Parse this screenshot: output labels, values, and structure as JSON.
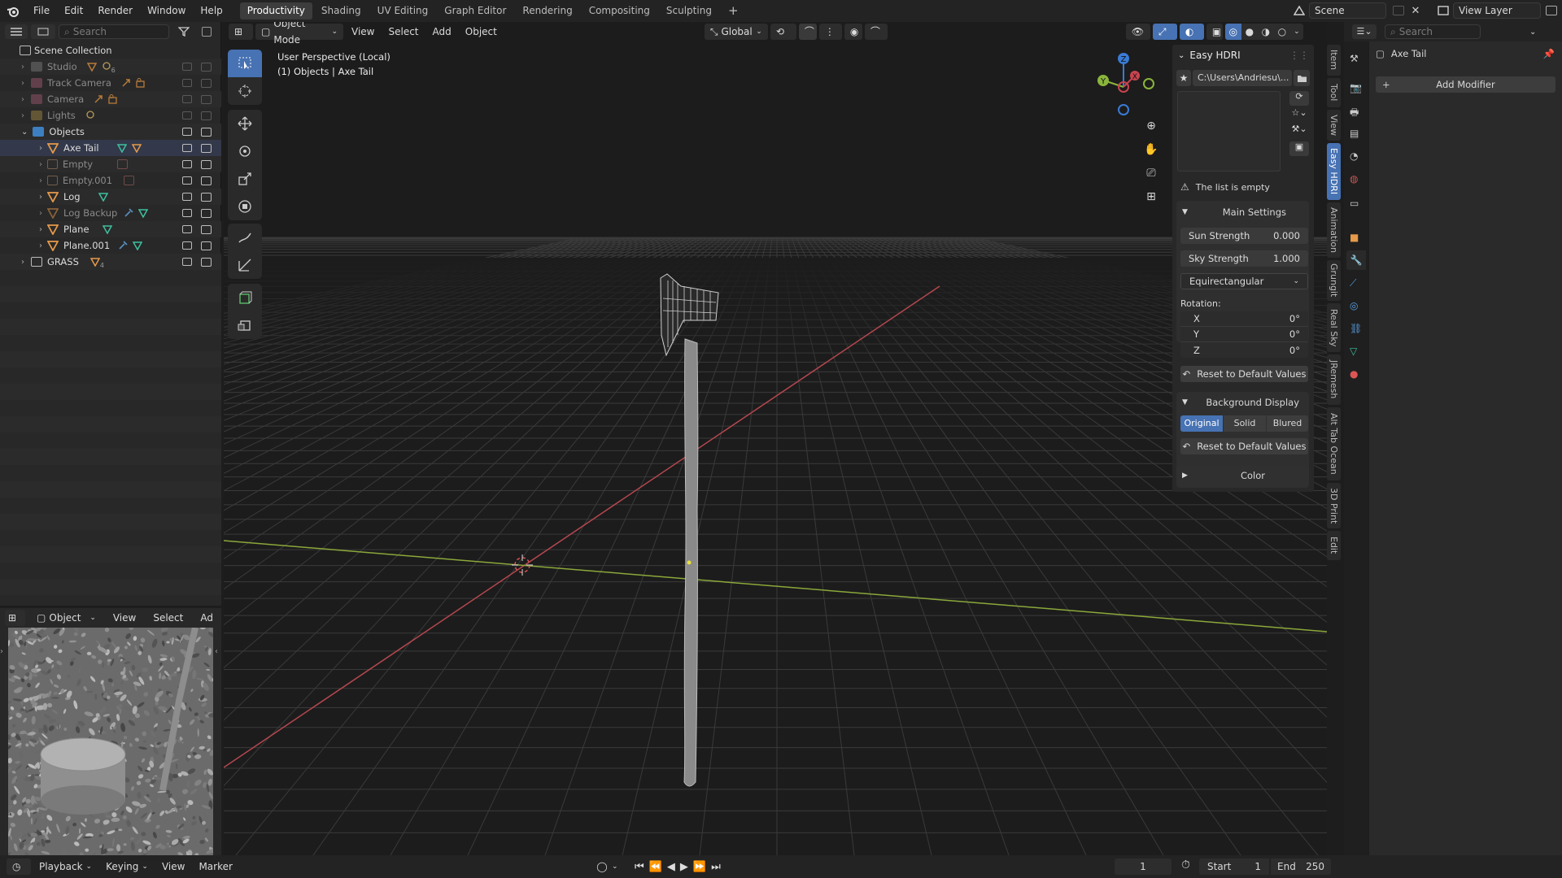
{
  "topbar": {
    "menus": [
      "File",
      "Edit",
      "Render",
      "Window",
      "Help"
    ],
    "workspaces": [
      "Productivity",
      "Shading",
      "UV Editing",
      "Graph Editor",
      "Rendering",
      "Compositing",
      "Sculpting"
    ],
    "active_workspace": "Productivity",
    "add_tab": "+",
    "scene": "Scene",
    "view_layer": "View Layer"
  },
  "outliner": {
    "search_placeholder": "Search",
    "root": "Scene Collection",
    "items": [
      {
        "label": "Studio",
        "sub": "6"
      },
      {
        "label": "Track Camera"
      },
      {
        "label": "Camera"
      },
      {
        "label": "Lights"
      },
      {
        "label": "Objects"
      },
      {
        "label": "Axe Tail"
      },
      {
        "label": "Empty"
      },
      {
        "label": "Empty.001"
      },
      {
        "label": "Log"
      },
      {
        "label": "Log Backup"
      },
      {
        "label": "Plane"
      },
      {
        "label": "Plane.001"
      },
      {
        "label": "GRASS",
        "sub": "4"
      }
    ]
  },
  "viewport": {
    "mode": "Object Mode",
    "menus": [
      "View",
      "Select",
      "Add",
      "Object"
    ],
    "transform": "Global",
    "perspective": "User Perspective (Local)",
    "context": "(1) Objects | Axe Tail",
    "gizmo": {
      "x": "X",
      "y": "Y",
      "z": "Z"
    }
  },
  "easy_hdri": {
    "title": "Easy HDRI",
    "path": "C:\\Users\\Andriesu\\...",
    "empty_msg": "The list is empty",
    "main_settings": "Main Settings",
    "sun_label": "Sun Strength",
    "sun_value": "0.000",
    "sky_label": "Sky Strength",
    "sky_value": "1.000",
    "projection": "Equirectangular",
    "rotation_label": "Rotation:",
    "rot": [
      {
        "axis": "X",
        "val": "0°"
      },
      {
        "axis": "Y",
        "val": "0°"
      },
      {
        "axis": "Z",
        "val": "0°"
      }
    ],
    "reset": "Reset to Default Values",
    "bg_display": "Background Display",
    "bg_options": [
      "Original",
      "Solid",
      "Blured"
    ],
    "bg_active": "Original",
    "color": "Color"
  },
  "sidebar_tabs": [
    "Item",
    "Tool",
    "View",
    "Easy HDRI",
    "Animation",
    "Grungit",
    "Real Sky",
    "JRemesh",
    "Alt Tab Ocean",
    "3D Print",
    "Edit"
  ],
  "sidebar_active": "Easy HDRI",
  "properties": {
    "search_placeholder": "Search",
    "object_name": "Axe Tail",
    "add_modifier": "Add Modifier"
  },
  "image_editor": {
    "mode": "Object Mode",
    "menus": [
      "View",
      "Select",
      "Ad"
    ]
  },
  "timeline": {
    "menus": [
      "Playback",
      "Keying",
      "View",
      "Marker"
    ],
    "current_frame": "1",
    "start_label": "Start",
    "start": "1",
    "end_label": "End",
    "end": "250"
  },
  "colors": {
    "accent": "#4772b3",
    "x_axis": "#c9444f",
    "y_axis": "#8ab53c",
    "z_axis": "#3a7bd5"
  }
}
